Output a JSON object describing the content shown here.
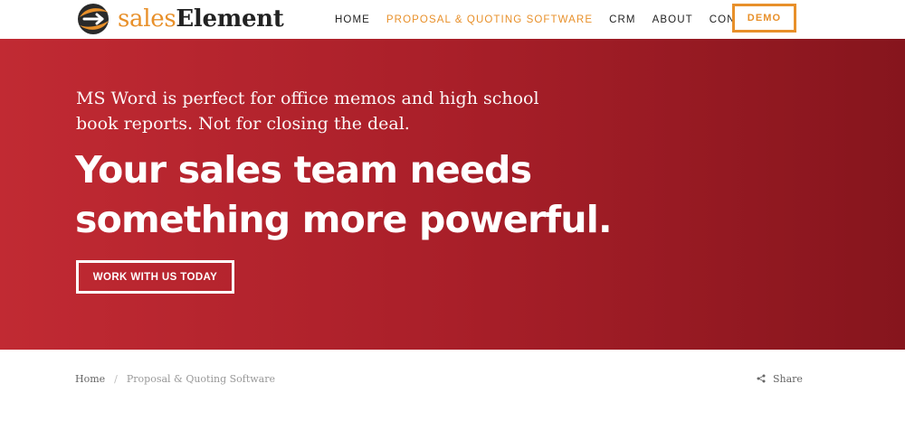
{
  "header": {
    "logo": {
      "word_light": "sales",
      "word_bold": "Element",
      "icon": "sales-element-logo-mark"
    },
    "nav": {
      "items": [
        {
          "label": "HOME",
          "active": false
        },
        {
          "label": "PROPOSAL & QUOTING SOFTWARE",
          "active": true
        },
        {
          "label": "CRM",
          "active": false
        },
        {
          "label": "ABOUT",
          "active": false
        },
        {
          "label": "CONTACT",
          "active": false
        }
      ]
    },
    "demo_label": "DEMO"
  },
  "hero": {
    "lead": "MS Word is perfect for office memos and high school book reports. Not for closing the deal.",
    "title_line1": "Your sales team needs",
    "title_line2": "something more powerful.",
    "cta_label": "WORK WITH US TODAY"
  },
  "breadcrumb": {
    "home": "Home",
    "separator": "/",
    "current": "Proposal & Quoting Software"
  },
  "share": {
    "label": "Share",
    "icon": "share-icon"
  },
  "colors": {
    "brand_orange": "#e8902a",
    "hero_red_start": "#c12a33",
    "hero_red_end": "#86151d",
    "text_dark": "#222222"
  }
}
